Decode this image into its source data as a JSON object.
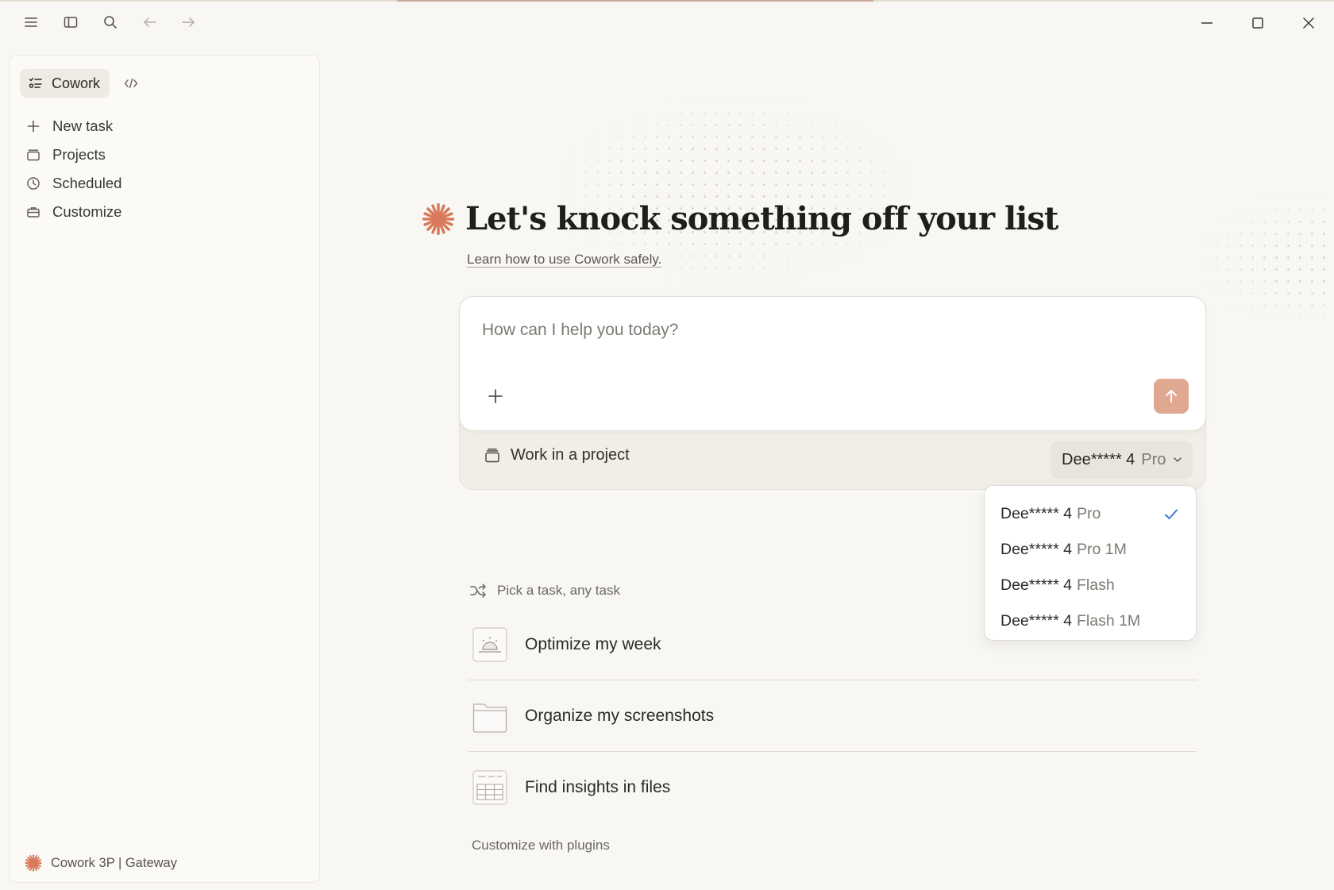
{
  "titlebar": {
    "icons": [
      "menu-icon",
      "sidebar-toggle-icon",
      "search-icon",
      "arrow-left-icon",
      "arrow-right-icon"
    ],
    "window_controls": [
      "minimize-icon",
      "maximize-icon",
      "close-icon"
    ]
  },
  "sidebar": {
    "mode_label": "Cowork",
    "nav": [
      {
        "label": "New task",
        "icon": "plus-icon"
      },
      {
        "label": "Projects",
        "icon": "folder-stack-icon"
      },
      {
        "label": "Scheduled",
        "icon": "clock-icon"
      },
      {
        "label": "Customize",
        "icon": "briefcase-icon"
      }
    ],
    "footer_label": "Cowork 3P | Gateway"
  },
  "main": {
    "headline": "Let's knock something off your list",
    "learn_link": "Learn how to use Cowork safely.",
    "composer": {
      "placeholder": "How can I help you today?",
      "value": ""
    },
    "project_label": "Work in a project",
    "model_selector": {
      "name": "Dee***** 4",
      "tier": "Pro"
    },
    "model_menu": [
      {
        "name": "Dee***** 4",
        "tier": "Pro",
        "selected": true
      },
      {
        "name": "Dee***** 4",
        "tier": "Pro 1M",
        "selected": false
      },
      {
        "name": "Dee***** 4",
        "tier": "Flash",
        "selected": false
      },
      {
        "name": "Dee***** 4",
        "tier": "Flash 1M",
        "selected": false
      }
    ],
    "tasks_header": "Pick a task, any task",
    "tasks": [
      {
        "label": "Optimize my week",
        "icon": "sunrise-icon"
      },
      {
        "label": "Organize my screenshots",
        "icon": "folder-icon"
      },
      {
        "label": "Find insights in files",
        "icon": "spreadsheet-icon"
      }
    ],
    "plugins_link": "Customize with plugins"
  },
  "colors": {
    "brand_orange": "#d9785a",
    "send_button": "#e0a791",
    "check_blue": "#3a78d9",
    "background": "#f8f7f3"
  }
}
